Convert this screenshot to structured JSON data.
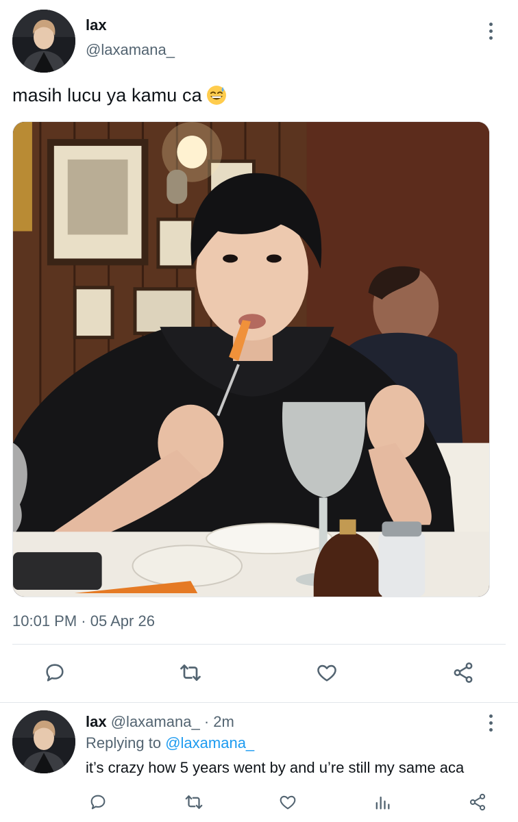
{
  "tweet": {
    "author_name": "lax",
    "author_handle": "@laxamana_",
    "text": "masih lucu ya kamu ca",
    "emoji": "grinning-face-with-sweat",
    "time": "10:01 PM",
    "separator": "·",
    "date": "05 Apr 26",
    "actions": [
      "reply",
      "retweet",
      "like",
      "share"
    ]
  },
  "reply": {
    "author_name": "lax",
    "author_handle": "@laxamana_",
    "separator": "·",
    "age": "2m",
    "replying_prefix": "Replying to",
    "replying_to": "@laxamana_",
    "text": "it’s crazy how 5 years went by and u’re still my same aca",
    "actions": [
      "reply",
      "retweet",
      "like",
      "analytics",
      "share"
    ]
  },
  "colors": {
    "text_primary": "#0f1419",
    "text_secondary": "#536471",
    "accent": "#1d9bf0",
    "divider": "#e1e6ea"
  }
}
